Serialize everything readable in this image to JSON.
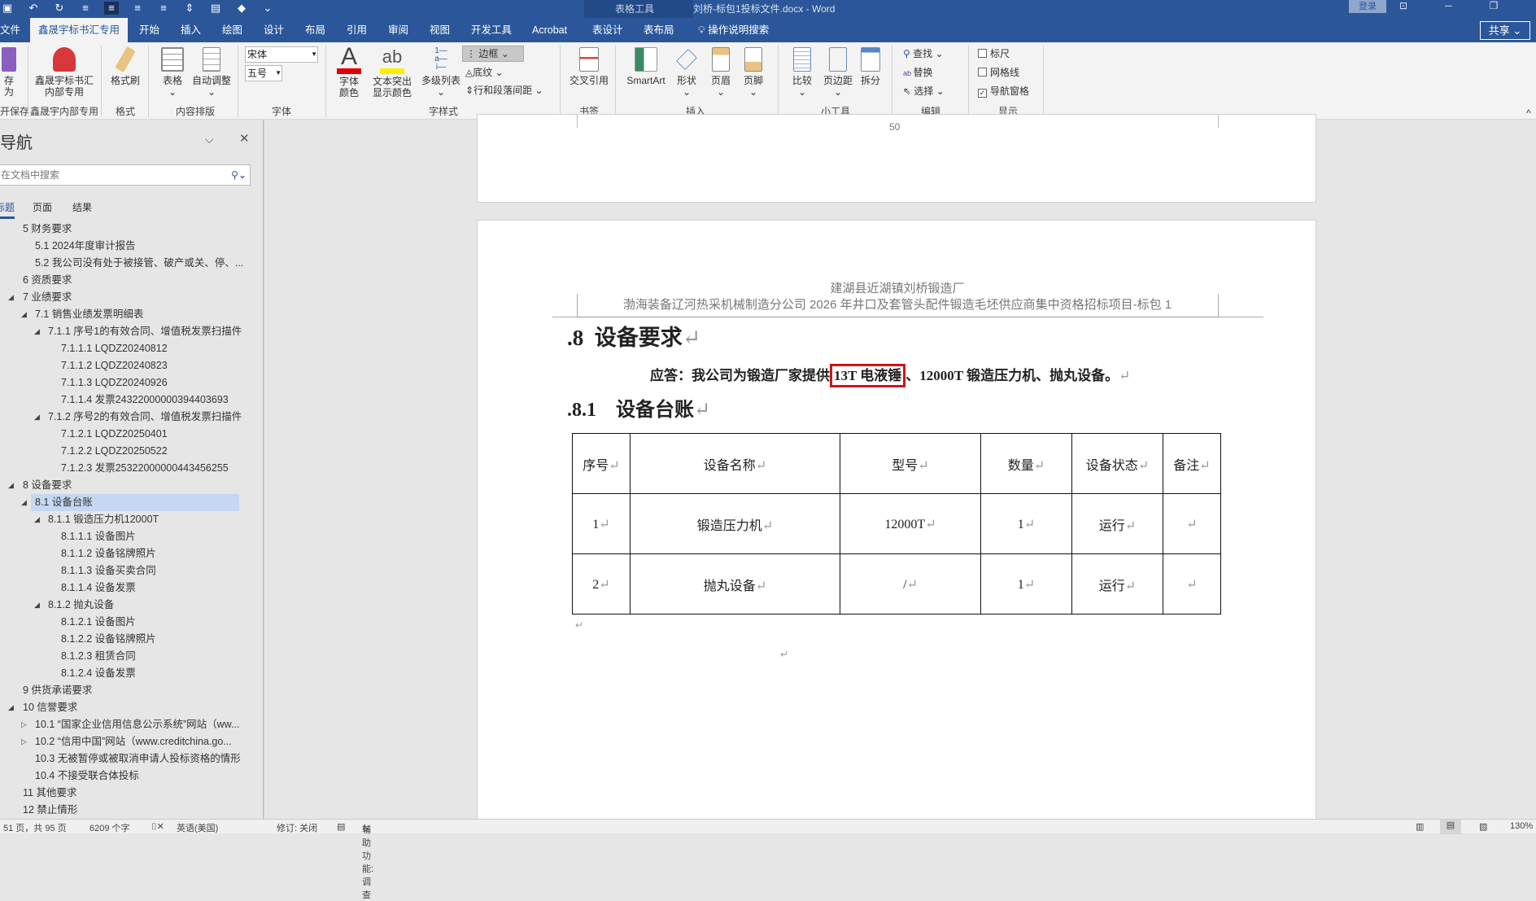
{
  "titlebar": {
    "context_label": "表格工具",
    "doc_title": "刘桥-标包1投标文件.docx  -  Word",
    "login": "登录",
    "share": "共享"
  },
  "tabs": [
    "文件",
    "鑫晟宇标书汇专用",
    "开始",
    "插入",
    "绘图",
    "设计",
    "布局",
    "引用",
    "审阅",
    "视图",
    "开发工具",
    "Acrobat",
    "表设计",
    "表布局",
    "操作说明搜索"
  ],
  "ribbon": {
    "save_as": "存为",
    "keep": "开保存",
    "xsy_btn": "鑫晟宇标书汇内部专用",
    "xsy_group": "鑫晟宇内部专用",
    "format_painter": "格式刷",
    "format_group": "格式",
    "table": "表格",
    "autofit": "自动调整",
    "content_group": "内容排版",
    "font_name": "宋体",
    "font_size": "五号",
    "font_group": "字体",
    "font_color": "字体颜色",
    "highlight": "文本突出显示颜色",
    "multilist": "多级列表",
    "border": "边框",
    "shading": "底纹",
    "spacing": "行和段落间距",
    "style_group": "字样式",
    "crossref": "交叉引用",
    "bookmark_group": "书签",
    "smartart": "SmartArt",
    "shape": "形状",
    "header": "页眉",
    "footer": "页脚",
    "insert_group": "插入",
    "compare": "比较",
    "margins": "页边距",
    "split": "拆分",
    "tools_group": "小工具",
    "find": "查找",
    "replace": "替换",
    "select": "选择",
    "edit_group": "编辑",
    "ruler": "标尺",
    "gridlines": "网格线",
    "navpane": "导航窗格",
    "show_group": "显示"
  },
  "nav": {
    "title": "导航",
    "search_placeholder": "在文档中搜索",
    "tabs": [
      "标题",
      "页面",
      "结果"
    ],
    "items": [
      {
        "label": "5 财务要求",
        "level": 1,
        "tri": ""
      },
      {
        "label": "5.1 2024年度审计报告",
        "level": 2,
        "tri": ""
      },
      {
        "label": "5.2 我公司没有处于被接管、破产或关、停、...",
        "level": 2,
        "tri": ""
      },
      {
        "label": "6 资质要求",
        "level": 1,
        "tri": ""
      },
      {
        "label": "7 业绩要求",
        "level": 1,
        "tri": "◢"
      },
      {
        "label": "7.1 销售业绩发票明细表",
        "level": 2,
        "tri": "◢"
      },
      {
        "label": "7.1.1 序号1的有效合同、增值税发票扫描件",
        "level": 3,
        "tri": "◢"
      },
      {
        "label": "7.1.1.1 LQDZ20240812",
        "level": 4,
        "tri": ""
      },
      {
        "label": "7.1.1.2 LQDZ20240823",
        "level": 4,
        "tri": ""
      },
      {
        "label": "7.1.1.3 LQDZ20240926",
        "level": 4,
        "tri": ""
      },
      {
        "label": "7.1.1.4 发票24322000000394403693",
        "level": 4,
        "tri": ""
      },
      {
        "label": "7.1.2 序号2的有效合同、增值税发票扫描件",
        "level": 3,
        "tri": "◢"
      },
      {
        "label": "7.1.2.1 LQDZ20250401",
        "level": 4,
        "tri": ""
      },
      {
        "label": "7.1.2.2 LQDZ20250522",
        "level": 4,
        "tri": ""
      },
      {
        "label": "7.1.2.3 发票25322000000443456255",
        "level": 4,
        "tri": ""
      },
      {
        "label": "8 设备要求",
        "level": 1,
        "tri": "◢"
      },
      {
        "label": "8.1 设备台账",
        "level": 2,
        "tri": "◢",
        "selected": true
      },
      {
        "label": "8.1.1 锻造压力机12000T",
        "level": 3,
        "tri": "◢"
      },
      {
        "label": "8.1.1.1 设备图片",
        "level": 4,
        "tri": ""
      },
      {
        "label": "8.1.1.2 设备铭牌照片",
        "level": 4,
        "tri": ""
      },
      {
        "label": "8.1.1.3 设备买卖合同",
        "level": 4,
        "tri": ""
      },
      {
        "label": "8.1.1.4 设备发票",
        "level": 4,
        "tri": ""
      },
      {
        "label": "8.1.2 抛丸设备",
        "level": 3,
        "tri": "◢"
      },
      {
        "label": "8.1.2.1 设备图片",
        "level": 4,
        "tri": ""
      },
      {
        "label": "8.1.2.2 设备铭牌照片",
        "level": 4,
        "tri": ""
      },
      {
        "label": "8.1.2.3 租赁合同",
        "level": 4,
        "tri": ""
      },
      {
        "label": "8.1.2.4 设备发票",
        "level": 4,
        "tri": ""
      },
      {
        "label": "9 供货承诺要求",
        "level": 1,
        "tri": ""
      },
      {
        "label": "10 信誉要求",
        "level": 1,
        "tri": "◢"
      },
      {
        "label": "10.1 “国家企业信用信息公示系统”网站（ww...",
        "level": 2,
        "tri": "▷"
      },
      {
        "label": "10.2 “信用中国”网站（www.creditchina.go...",
        "level": 2,
        "tri": "▷"
      },
      {
        "label": "10.3 无被暂停或被取消申请人投标资格的情形",
        "level": 2,
        "tri": ""
      },
      {
        "label": "10.4 不接受联合体投标",
        "level": 2,
        "tri": ""
      },
      {
        "label": "11 其他要求",
        "level": 1,
        "tri": ""
      },
      {
        "label": "12 禁止情形",
        "level": 1,
        "tri": ""
      }
    ]
  },
  "document": {
    "prev_page_number": "50",
    "header_line1": "建湖县近湖镇刘桥锻造厂",
    "header_line2": "渤海装备辽河热采机械制造分公司 2026 年井口及套管头配件锻造毛坯供应商集中资格招标项目-标包 1",
    "heading": ".8  设备要求",
    "response_prefix": "应答：我公司为锻造厂家提供",
    "response_highlight": "13T 电液锤",
    "response_suffix": "、12000T 锻造压力机、抛丸设备。",
    "subheading": ".8.1    设备台账",
    "table": {
      "headers": [
        "序号",
        "设备名称",
        "型号",
        "数量",
        "设备状态",
        "备注"
      ],
      "rows": [
        [
          "1",
          "锻造压力机",
          "12000T",
          "1",
          "运行",
          ""
        ],
        [
          "2",
          "抛丸设备",
          "/",
          "1",
          "运行",
          ""
        ]
      ]
    },
    "highlight_color": "#d0121b"
  },
  "status": {
    "page": "51 页，共 95 页",
    "words": "6209 个字",
    "language": "英语(美国)",
    "track": "修订: 关闭",
    "accessibility": "辅助功能: 调查",
    "zoom": "130%"
  }
}
